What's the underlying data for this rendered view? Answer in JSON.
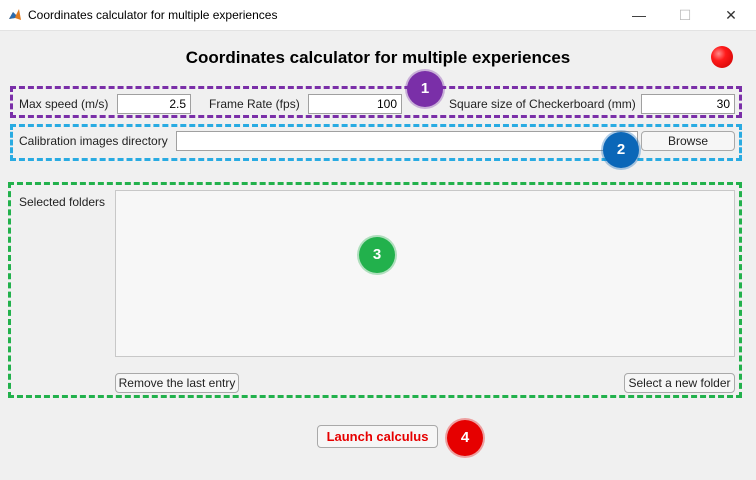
{
  "window": {
    "title": "Coordinates calculator for multiple experiences",
    "minimize_glyph": "—",
    "maximize_glyph": "☐",
    "close_glyph": "✕"
  },
  "header": {
    "title": "Coordinates calculator for multiple experiences",
    "status_color": "#ff0000"
  },
  "params": {
    "max_speed_label": "Max speed (m/s)",
    "max_speed_value": "2.5",
    "frame_rate_label": "Frame Rate (fps)",
    "frame_rate_value": "100",
    "square_size_label": "Square size of Checkerboard (mm)",
    "square_size_value": "30"
  },
  "calibration": {
    "label": "Calibration images directory",
    "value": "",
    "browse_label": "Browse"
  },
  "folders": {
    "label": "Selected folders",
    "items": [],
    "remove_label": "Remove the last entry",
    "select_label": "Select a new folder"
  },
  "launch": {
    "label": "Launch calculus"
  },
  "markers": [
    {
      "number": "1",
      "color": "#7a2fa8"
    },
    {
      "number": "2",
      "color": "#0b67b8"
    },
    {
      "number": "3",
      "color": "#22b14c"
    },
    {
      "number": "4",
      "color": "#e60000"
    }
  ]
}
